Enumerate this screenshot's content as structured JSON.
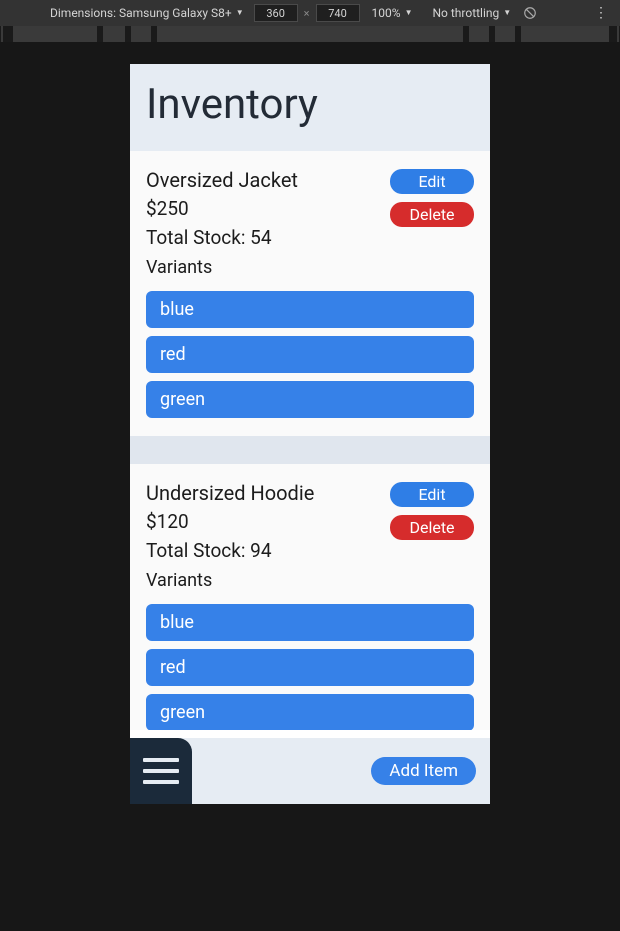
{
  "devtools": {
    "device_label": "Dimensions: Samsung Galaxy S8+",
    "width": "360",
    "height": "740",
    "zoom": "100%",
    "throttling": "No throttling"
  },
  "app": {
    "title": "Inventory",
    "edit_label": "Edit",
    "delete_label": "Delete",
    "variants_label": "Variants",
    "total_stock_label_prefix": "Total Stock: ",
    "add_item_label": "Add Item"
  },
  "items": [
    {
      "name": "Oversized Jacket",
      "price": "$250",
      "stock": "54",
      "variants": [
        "blue",
        "red",
        "green"
      ]
    },
    {
      "name": "Undersized Hoodie",
      "price": "$120",
      "stock": "94",
      "variants": [
        "blue",
        "red",
        "green"
      ]
    }
  ]
}
